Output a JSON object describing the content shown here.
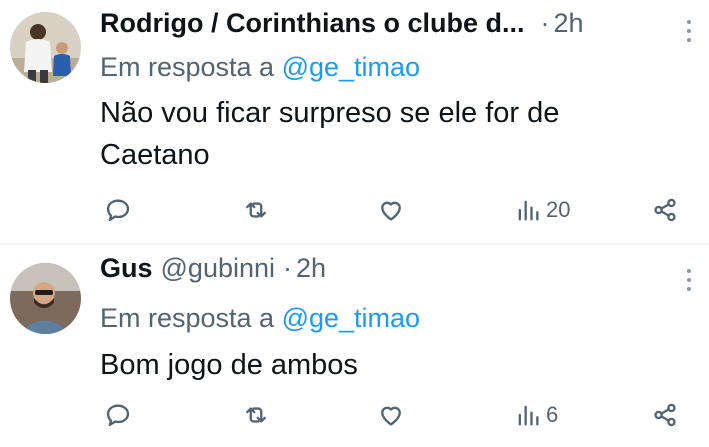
{
  "tweets": [
    {
      "name": "Rodrigo / Corinthians o clube d...",
      "handle": "",
      "time": "2h",
      "reply_prefix": "Em resposta a",
      "reply_mention": "@ge_timao",
      "text": "Não vou ficar surpreso se ele for de Caetano",
      "views": "20"
    },
    {
      "name": "Gus",
      "handle": "@gubinni",
      "time": "2h",
      "reply_prefix": "Em resposta a",
      "reply_mention": "@ge_timao",
      "text": "Bom jogo de ambos",
      "views": "6"
    }
  ],
  "icons": {
    "reply": "reply-icon",
    "retweet": "retweet-icon",
    "like": "heart-icon",
    "views": "views-icon",
    "share": "share-icon",
    "more": "more-icon"
  },
  "colors": {
    "link": "#1d9bf0",
    "secondary": "#536471",
    "primary": "#0f1419",
    "divider": "#eff3f4"
  }
}
